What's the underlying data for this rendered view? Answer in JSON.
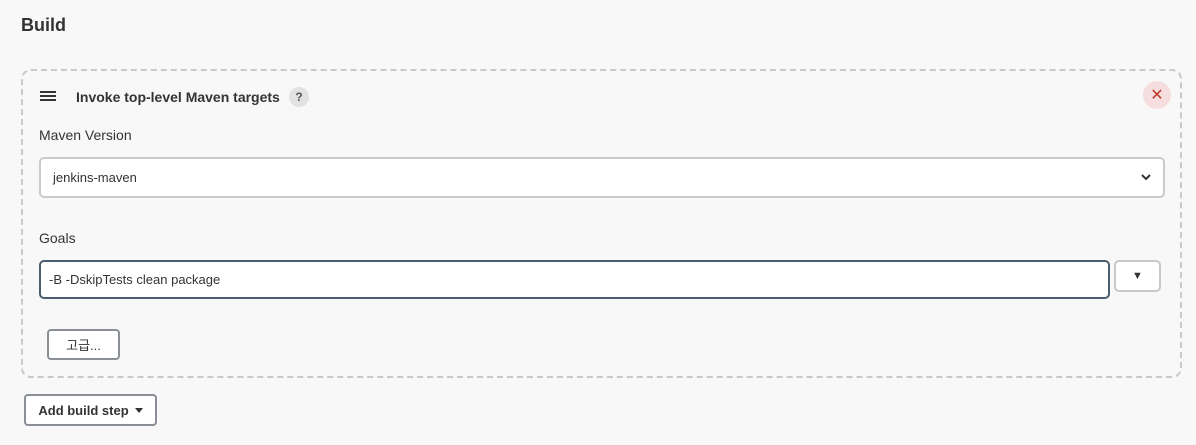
{
  "section": {
    "title": "Build"
  },
  "step": {
    "title": "Invoke top-level Maven targets",
    "help_symbol": "?",
    "close_symbol": "✕",
    "maven_version": {
      "label": "Maven Version",
      "selected": "jenkins-maven"
    },
    "goals": {
      "label": "Goals",
      "value": "-B -DskipTests clean package",
      "expand_symbol": "▼"
    },
    "advanced_label": "고급..."
  },
  "add_build_step_label": "Add build step",
  "icons": {
    "drag": "drag-handle-icon",
    "help": "help-icon",
    "close": "close-icon",
    "select_arrow": "chevron-down-icon",
    "expand": "triangle-down-icon",
    "caret": "caret-down-icon"
  },
  "colors": {
    "background": "#f8f8f8",
    "close_bg": "#f7dede",
    "close_fg": "#c0392b",
    "input_focus_border": "#4b5d6e"
  }
}
